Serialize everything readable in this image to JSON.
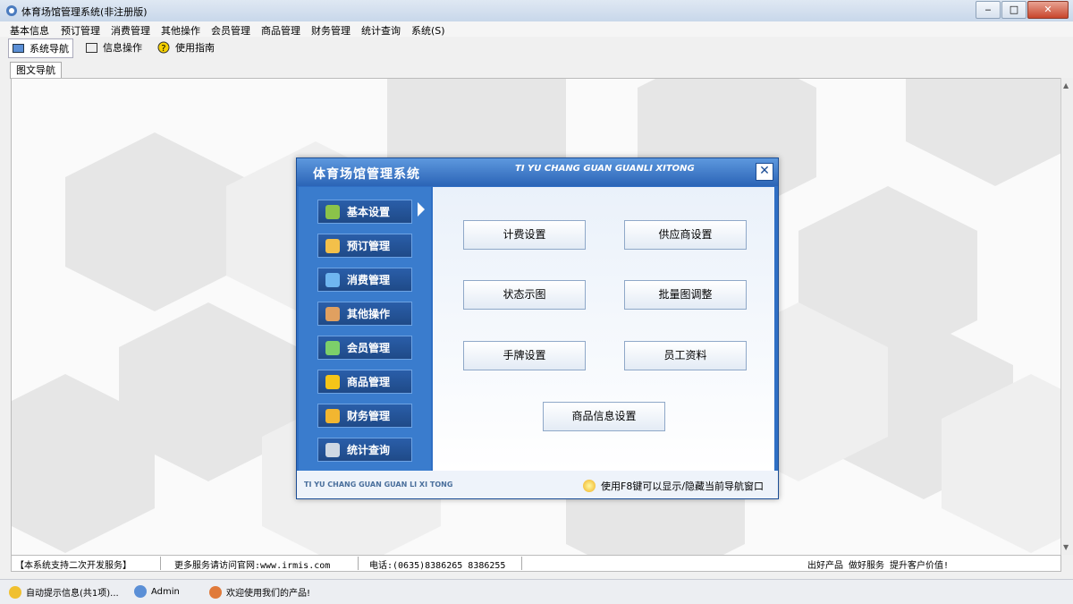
{
  "window": {
    "title": "体育场馆管理系统(非注册版)",
    "min": "‒",
    "max": "□",
    "close": "✕"
  },
  "menu": [
    "基本信息",
    "预订管理",
    "消费管理",
    "其他操作",
    "会员管理",
    "商品管理",
    "财务管理",
    "统计查询",
    "系统(S)"
  ],
  "toolbar": {
    "nav": "系统导航",
    "info": "信息操作",
    "guide": "使用指南"
  },
  "tab": "图文导航",
  "dialog": {
    "title": "体育场馆管理系统",
    "subtitle": "TI YU CHANG GUAN GUANLI XITONG",
    "close": "✕",
    "nav": [
      "基本设置",
      "预订管理",
      "消费管理",
      "其他操作",
      "会员管理",
      "商品管理",
      "财务管理",
      "统计查询"
    ],
    "buttons": {
      "billing": "计费设置",
      "supplier": "供应商设置",
      "status": "状态示图",
      "batch": "批量图调整",
      "wristband": "手牌设置",
      "staff": "员工资料",
      "goods": "商品信息设置"
    },
    "footer_left": "TI YU CHANG GUAN GUAN LI XI TONG",
    "footer_tip": "使用F8键可以显示/隐藏当前导航窗口"
  },
  "status": {
    "service": "【本系统支持二次开发服务】",
    "website": "更多服务请访问官网:www.irmis.com",
    "phone": "电话:(0635)8386265 8386255",
    "slogan": "出好产品 做好服务 提升客户价值!"
  },
  "bottom": {
    "notice": "自动提示信息(共1项)...",
    "user": "Admin",
    "welcome": "欢迎使用我们的产品!"
  },
  "colors": {
    "dialog_blue": "#2f6fc4",
    "nav_button": "#1f4a88"
  }
}
